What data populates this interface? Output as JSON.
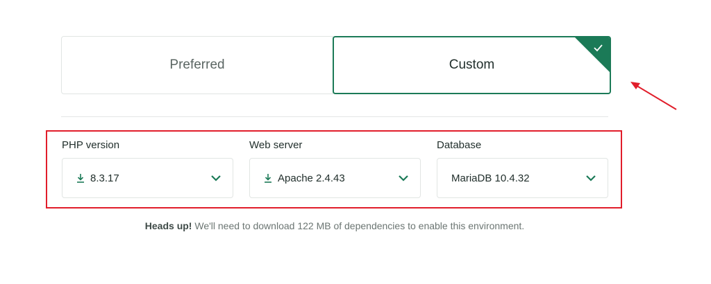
{
  "env_toggle": {
    "preferred_label": "Preferred",
    "custom_label": "Custom",
    "selected": "Custom"
  },
  "fields": {
    "php": {
      "label": "PHP version",
      "value": "8.3.17",
      "icon": "download-icon"
    },
    "web": {
      "label": "Web server",
      "value": "Apache 2.4.43",
      "icon": "download-icon"
    },
    "db": {
      "label": "Database",
      "value": "MariaDB 10.4.32"
    }
  },
  "note": {
    "strong": "Heads up!",
    "text": " We'll need to download 122 MB of dependencies to enable this environment."
  },
  "colors": {
    "accent": "#1b7a57",
    "highlight": "#e11d2a"
  }
}
